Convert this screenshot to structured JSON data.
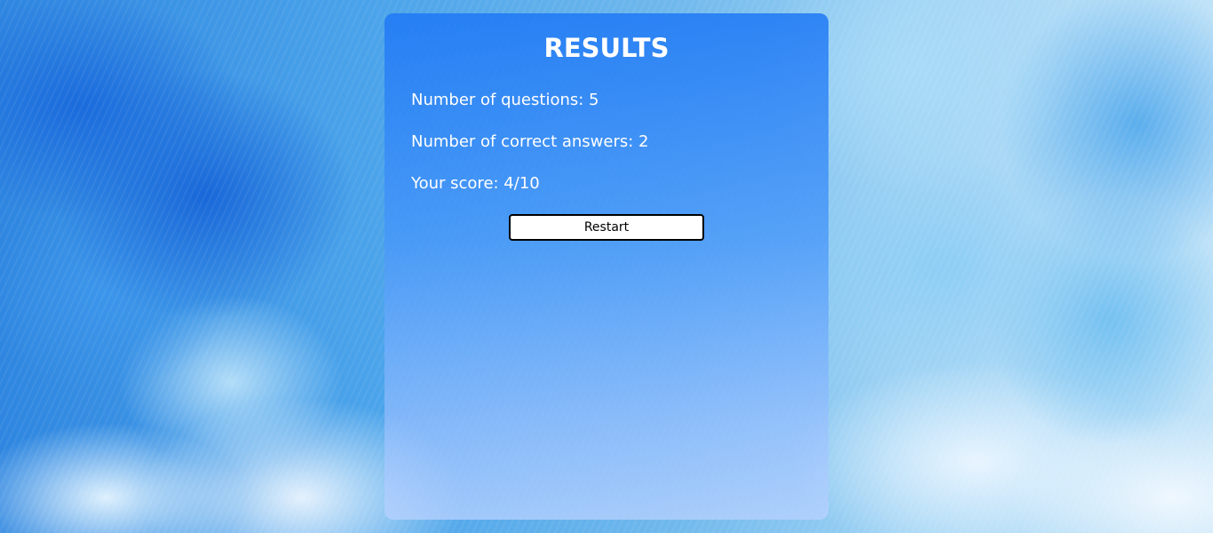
{
  "results": {
    "title": "RESULTS",
    "questions_line": "Number of questions: 5",
    "correct_line": "Number of correct answers: 2",
    "score_line": "Your score: 4/10",
    "restart_label": "Restart"
  },
  "colors": {
    "card_top": "#1e78f5",
    "card_bottom": "#b9d2ff",
    "text": "#ffffff",
    "button_bg": "#ffffff",
    "button_border": "#000000"
  }
}
